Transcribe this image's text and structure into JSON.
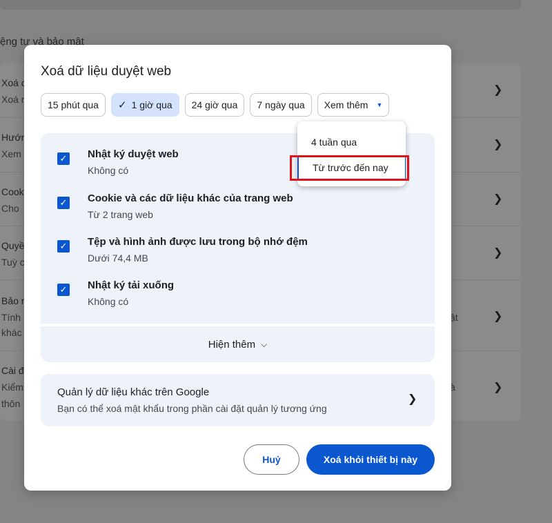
{
  "background": {
    "section_title": "ệng tư và bảo mật",
    "rows": [
      {
        "t1": "Xoá c",
        "t2": "Xoá n",
        "trail": ""
      },
      {
        "t1": "Hướn",
        "t2": "Xem",
        "trail": ""
      },
      {
        "t1": "Cook",
        "t2": "Cho",
        "trail": ""
      },
      {
        "t1": "Quyề",
        "t2": "Tuỳ c",
        "trail": ""
      },
      {
        "t1": "Bảo m",
        "t2": "Tính",
        "t3": "khác",
        "trail": "ật"
      },
      {
        "t1": "Cài đ",
        "t2": "Kiểm",
        "t3": "thôn",
        "trail": "à"
      }
    ]
  },
  "dialog": {
    "title": "Xoá dữ liệu duyệt web",
    "chips": [
      {
        "label": "15 phút qua"
      },
      {
        "label": "1 giờ qua",
        "selected": true
      },
      {
        "label": "24 giờ qua"
      },
      {
        "label": "7 ngày qua"
      },
      {
        "label": "Xem thêm"
      }
    ],
    "items": [
      {
        "title": "Nhật ký duyệt web",
        "sub": "Không có",
        "checked": true
      },
      {
        "title": "Cookie và các dữ liệu khác của trang web",
        "sub": "Từ 2 trang web",
        "checked": true
      },
      {
        "title": "Tệp và hình ảnh được lưu trong bộ nhớ đệm",
        "sub": "Dưới 74,4 MB",
        "checked": true
      },
      {
        "title": "Nhật ký tải xuống",
        "sub": "Không có",
        "checked": true
      }
    ],
    "show_more": "Hiện thêm",
    "google": {
      "title": "Quản lý dữ liệu khác trên Google",
      "sub": "Bạn có thể xoá mật khẩu trong phần cài đặt quản lý tương ứng"
    },
    "cancel": "Huỷ",
    "clear": "Xoá khỏi thiết bị này"
  },
  "menu": {
    "items": [
      "4 tuần qua",
      "Từ trước đến nay"
    ]
  },
  "icons": {
    "check": "✓",
    "caret_down": "▼",
    "chevron_right": "›",
    "chevron_down": "⌄"
  },
  "colors": {
    "accent": "#0b57d0",
    "selected_chip": "#d3e3fd",
    "panel": "#eef2f9",
    "highlight": "#e0151c"
  }
}
